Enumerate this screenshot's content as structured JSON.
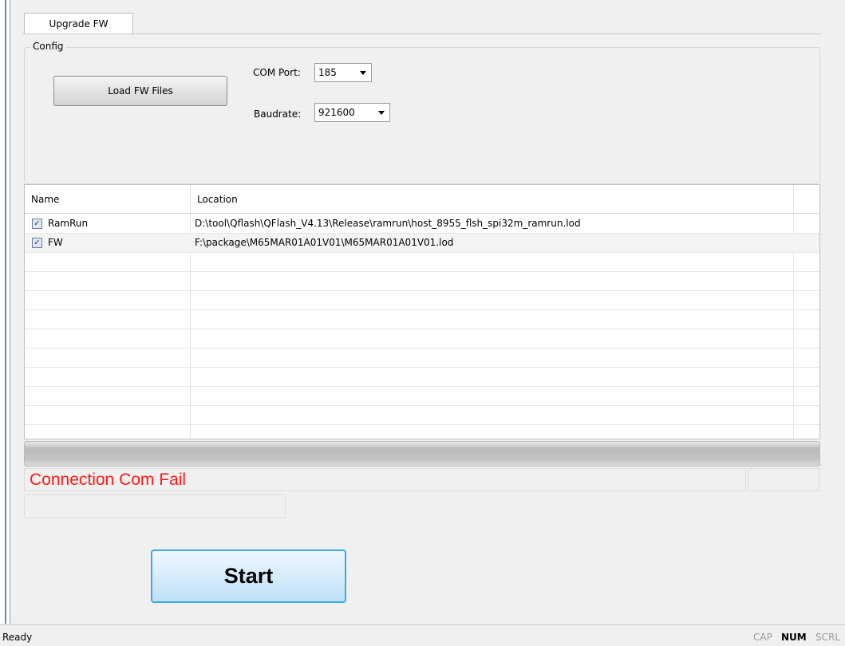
{
  "tab": {
    "label": "Upgrade FW"
  },
  "config": {
    "legend": "Config",
    "load_button": "Load FW Files",
    "com_port_label": "COM Port:",
    "com_port_value": "185",
    "baudrate_label": "Baudrate:",
    "baudrate_value": "921600"
  },
  "table": {
    "headers": [
      "Name",
      "Location"
    ],
    "rows": [
      {
        "name": "RamRun",
        "checked": true,
        "location": "D:\\tool\\Qflash\\QFlash_V4.13\\Release\\ramrun\\host_8955_flsh_spi32m_ramrun.lod"
      },
      {
        "name": "FW",
        "checked": true,
        "location": "F:\\package\\M65MAR01A01V01\\M65MAR01A01V01.lod"
      }
    ]
  },
  "status": {
    "message": "Connection Com Fail",
    "message_color": "#ff1a1a"
  },
  "start_button": "Start",
  "statusbar": {
    "text": "Ready",
    "indicators": [
      {
        "label": "CAP",
        "active": false
      },
      {
        "label": "NUM",
        "active": true
      },
      {
        "label": "SCRL",
        "active": false
      }
    ]
  }
}
